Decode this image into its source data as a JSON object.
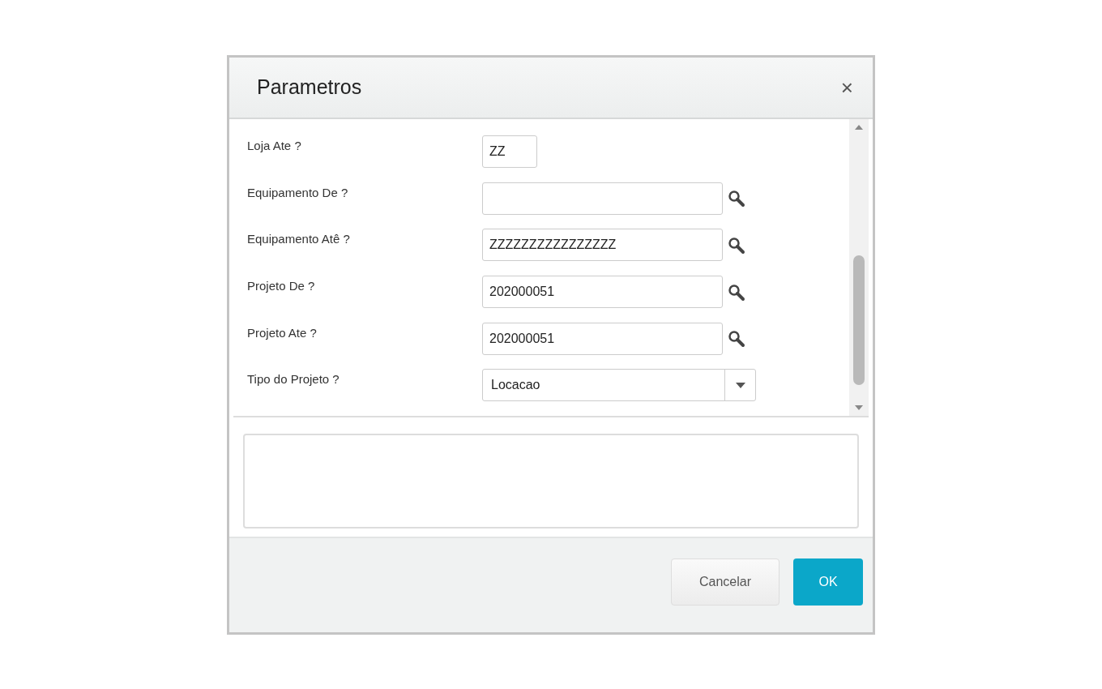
{
  "dialog": {
    "title": "Parametros",
    "close": "×"
  },
  "fields": [
    {
      "label": "Loja Ate ?",
      "kind": "short",
      "value": "ZZ"
    },
    {
      "label": "Equipamento De ?",
      "kind": "lookup"
    },
    {
      "label": "Equipamento Atê ?",
      "kind": "lookup",
      "value": "ZZZZZZZZZZZZZZZZ"
    },
    {
      "label": "Projeto De ?",
      "kind": "lookup",
      "value": "202000051"
    },
    {
      "label": "Projeto Ate ?",
      "kind": "lookup",
      "value": "202000051"
    },
    {
      "label": "Tipo do Projeto ?",
      "kind": "select",
      "value": "Locacao"
    }
  ],
  "buttons": [
    {
      "label": "Cancelar",
      "kind": "secondary"
    },
    {
      "label": "OK",
      "kind": "primary"
    }
  ]
}
